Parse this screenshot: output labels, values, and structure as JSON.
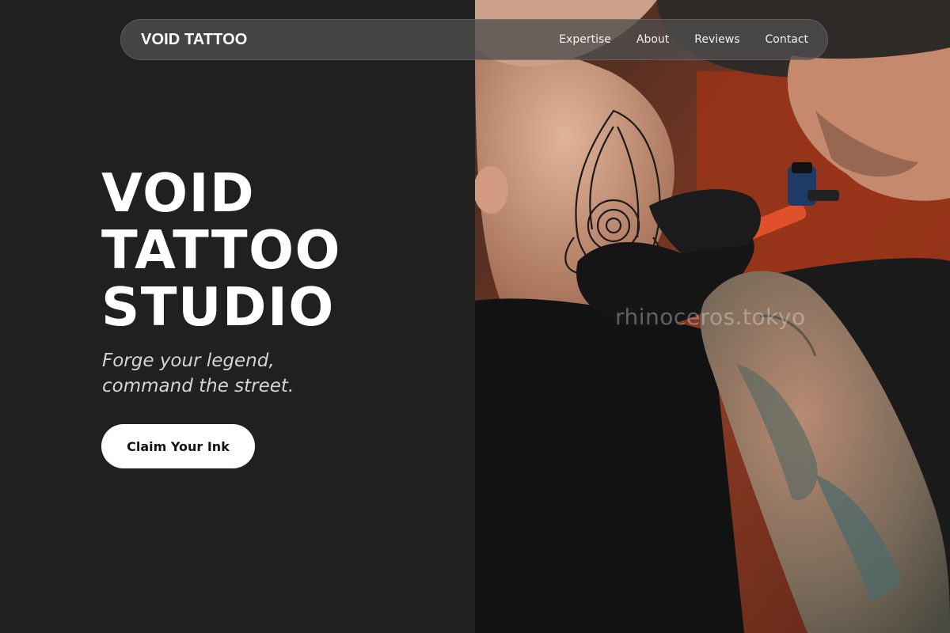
{
  "nav": {
    "brand": "VOID TATTOO",
    "links": [
      "Expertise",
      "About",
      "Reviews",
      "Contact"
    ]
  },
  "hero": {
    "title_lines": [
      "VOID",
      "TATTOO",
      "STUDIO"
    ],
    "tagline_lines": [
      "Forge your legend,",
      "command the street."
    ],
    "cta_label": "Claim Your Ink"
  },
  "photo": {
    "subject": "tattoo artist in black gloves inking a floral neck tattoo",
    "watermark": "rhinoceros.tokyo"
  },
  "colors": {
    "background": "#202020",
    "nav_background": "#4e4e4e",
    "text": "#ffffff",
    "tagline": "#d4d4d4",
    "cta_background": "#ffffff",
    "cta_text": "#111111"
  }
}
